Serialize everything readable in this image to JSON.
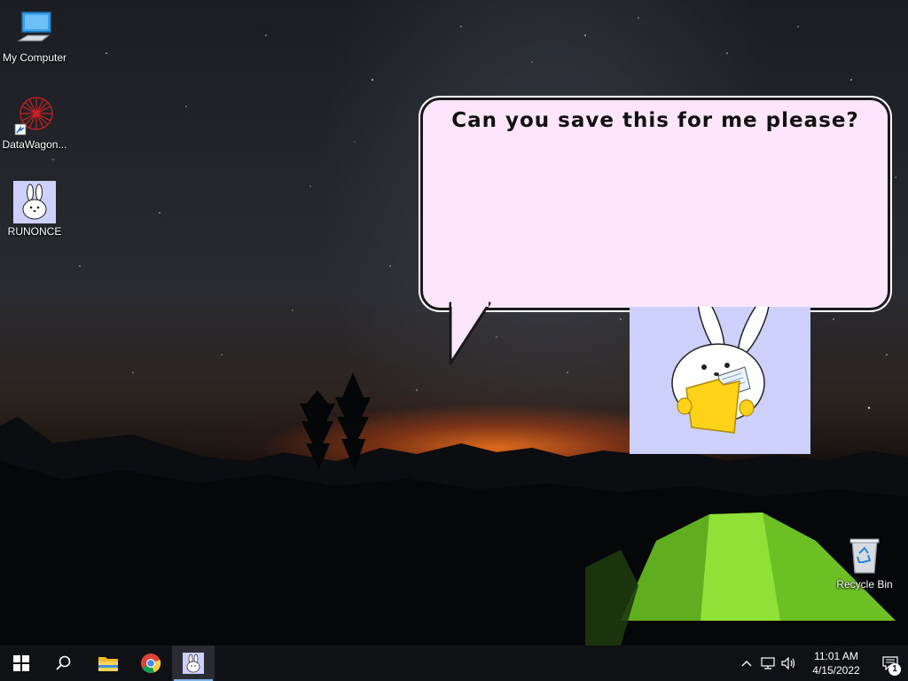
{
  "desktop": {
    "icons": [
      {
        "label": "My Computer",
        "icon": "my-computer-icon"
      },
      {
        "label": "DataWagon...",
        "icon": "datawagon-shortcut-icon"
      },
      {
        "label": "RUNONCE",
        "icon": "runonce-bunny-icon"
      },
      {
        "label": "Recycle Bin",
        "icon": "recycle-bin-icon"
      }
    ]
  },
  "popup": {
    "message": "Can you save this for me please?",
    "background_color": "#fde6fb",
    "character_panel_color": "#ccd0fb"
  },
  "taskbar": {
    "buttons": [
      {
        "name": "start",
        "icon": "windows-start-icon"
      },
      {
        "name": "search",
        "icon": "search-icon"
      },
      {
        "name": "file-explorer",
        "icon": "folder-icon"
      },
      {
        "name": "chrome",
        "icon": "chrome-icon"
      },
      {
        "name": "runonce-app",
        "icon": "bunny-app-icon",
        "active": true
      }
    ],
    "tray": {
      "time": "11:01 AM",
      "date": "4/15/2022",
      "notification_count": "1"
    }
  }
}
